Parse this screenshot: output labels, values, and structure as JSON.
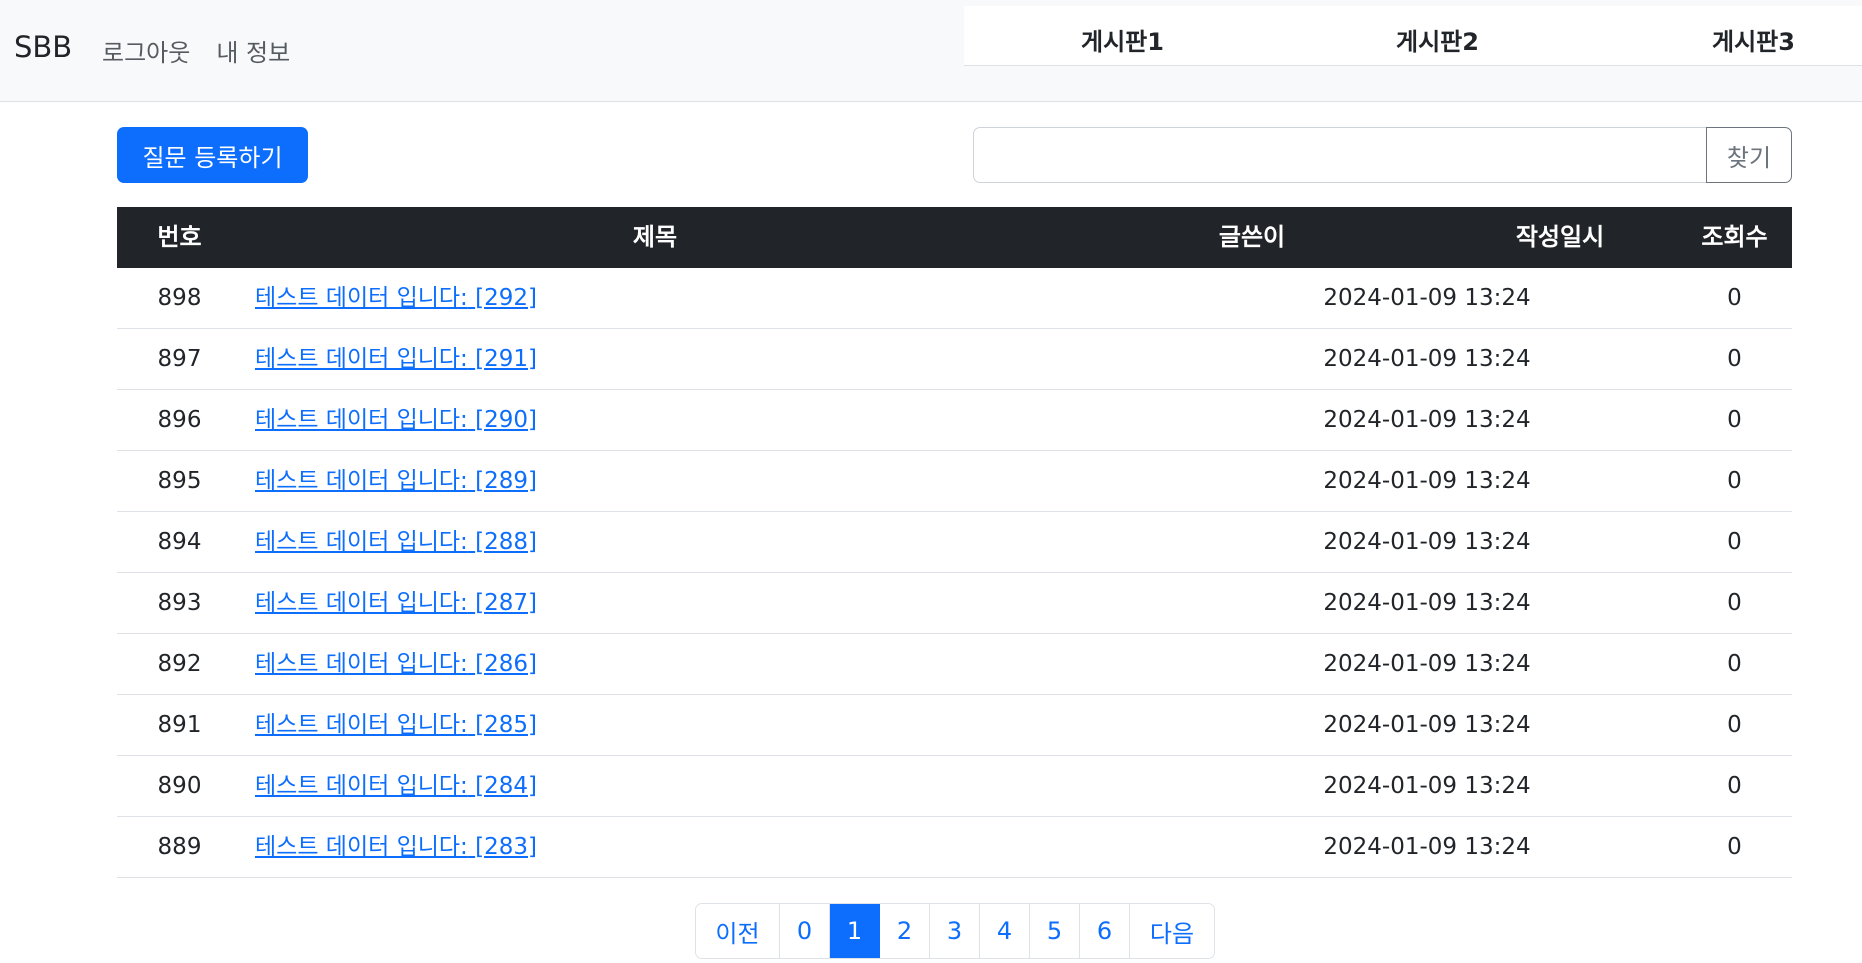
{
  "navbar": {
    "brand": "SBB",
    "links": [
      "로그아웃",
      "내 정보"
    ],
    "boards": [
      "게시판1",
      "게시판2",
      "게시판3"
    ]
  },
  "actions": {
    "create_label": "질문 등록하기",
    "search_value": "",
    "search_button": "찾기"
  },
  "table": {
    "headers": [
      "번호",
      "제목",
      "글쓴이",
      "작성일시",
      "조회수"
    ],
    "rows": [
      {
        "num": "898",
        "title": "테스트 데이터 입니다:",
        "comments": "[292]",
        "author": "",
        "date": "2024-01-09 13:24",
        "views": "0"
      },
      {
        "num": "897",
        "title": "테스트 데이터 입니다:",
        "comments": "[291]",
        "author": "",
        "date": "2024-01-09 13:24",
        "views": "0"
      },
      {
        "num": "896",
        "title": "테스트 데이터 입니다:",
        "comments": "[290]",
        "author": "",
        "date": "2024-01-09 13:24",
        "views": "0"
      },
      {
        "num": "895",
        "title": "테스트 데이터 입니다:",
        "comments": "[289]",
        "author": "",
        "date": "2024-01-09 13:24",
        "views": "0"
      },
      {
        "num": "894",
        "title": "테스트 데이터 입니다:",
        "comments": "[288]",
        "author": "",
        "date": "2024-01-09 13:24",
        "views": "0"
      },
      {
        "num": "893",
        "title": "테스트 데이터 입니다:",
        "comments": "[287]",
        "author": "",
        "date": "2024-01-09 13:24",
        "views": "0"
      },
      {
        "num": "892",
        "title": "테스트 데이터 입니다:",
        "comments": "[286]",
        "author": "",
        "date": "2024-01-09 13:24",
        "views": "0"
      },
      {
        "num": "891",
        "title": "테스트 데이터 입니다:",
        "comments": "[285]",
        "author": "",
        "date": "2024-01-09 13:24",
        "views": "0"
      },
      {
        "num": "890",
        "title": "테스트 데이터 입니다:",
        "comments": "[284]",
        "author": "",
        "date": "2024-01-09 13:24",
        "views": "0"
      },
      {
        "num": "889",
        "title": "테스트 데이터 입니다:",
        "comments": "[283]",
        "author": "",
        "date": "2024-01-09 13:24",
        "views": "0"
      }
    ]
  },
  "pagination": {
    "prev": "이전",
    "pages": [
      "0",
      "1",
      "2",
      "3",
      "4",
      "5",
      "6"
    ],
    "active": "1",
    "next": "다음"
  },
  "colors": {
    "primary": "#0d6efd",
    "header_dark": "#212529",
    "navbar_bg": "#f8f9fa"
  }
}
